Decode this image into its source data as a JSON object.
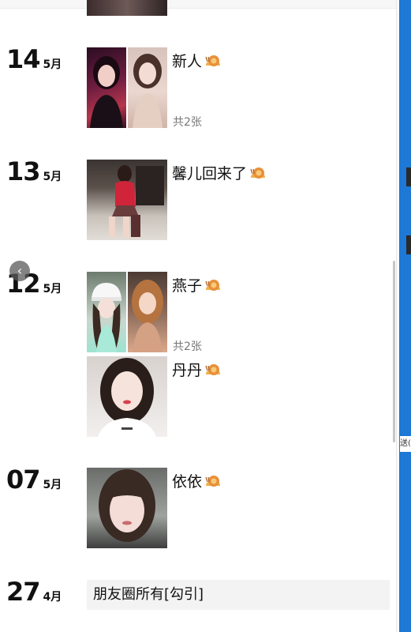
{
  "posts": [
    {
      "day": "14",
      "month": "5月",
      "caption": "新人",
      "count_label": "共2张"
    },
    {
      "day": "13",
      "month": "5月",
      "caption": "馨儿回来了"
    },
    {
      "day": "12",
      "month": "5月",
      "caption": "燕子",
      "count_label": "共2张"
    },
    {
      "caption": "丹丹"
    },
    {
      "day": "07",
      "month": "5月",
      "caption": "依依"
    },
    {
      "day": "27",
      "month": "4月",
      "text": "朋友圈所有[勾引]"
    }
  ],
  "edge_text": "送(",
  "icons": {
    "snail": "snail-emoji-icon",
    "back": "chevron-left-icon"
  },
  "colors": {
    "accent_strip": "#1e78d6",
    "count_text": "#777777",
    "text_post_bg": "#f3f3f3"
  }
}
